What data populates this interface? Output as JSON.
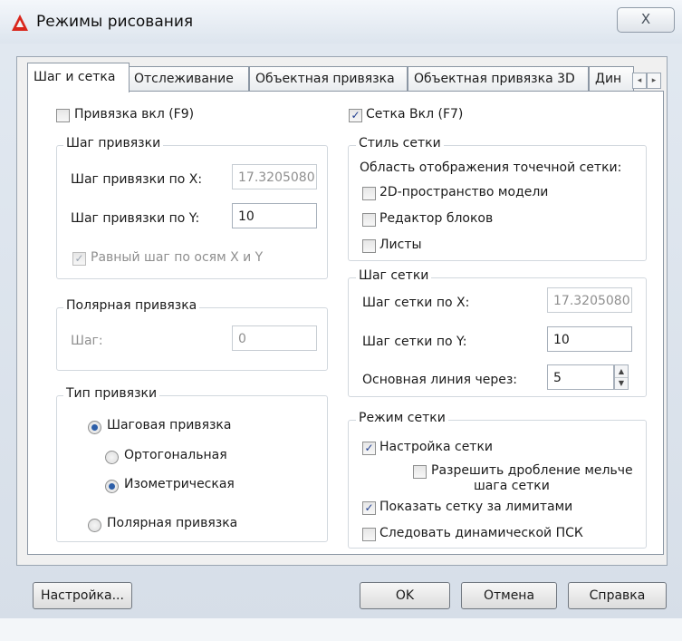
{
  "window": {
    "title": "Режимы рисования",
    "close_glyph": "X"
  },
  "tabs": [
    {
      "label": "Шаг и сетка",
      "active": true
    },
    {
      "label": "Отслеживание",
      "active": false
    },
    {
      "label": "Объектная привязка",
      "active": false
    },
    {
      "label": "Объектная привязка 3D",
      "active": false
    },
    {
      "label": "Дин",
      "active": false
    }
  ],
  "tab_scroll": {
    "left": "◂",
    "right": "▸"
  },
  "snap": {
    "enable": {
      "label": "Привязка вкл (F9)",
      "checked": false
    },
    "spacing": {
      "title": "Шаг привязки",
      "x_label": "Шаг привязки по X:",
      "x_value": "17.3205080",
      "y_label": "Шаг привязки по Y:",
      "y_value": "10",
      "equal": {
        "label": "Равный шаг по осям X и Y",
        "checked": true
      }
    },
    "polar": {
      "title": "Полярная привязка",
      "step_label": "Шаг:",
      "step_value": "0"
    },
    "type": {
      "title": "Тип привязки",
      "grid_snap": {
        "label": "Шаговая привязка",
        "selected": true
      },
      "rectangular": {
        "label": "Ортогональная",
        "selected": false
      },
      "isometric": {
        "label": "Изометрическая",
        "selected": true
      },
      "polar_snap": {
        "label": "Полярная привязка",
        "selected": false
      }
    }
  },
  "grid": {
    "enable": {
      "label": "Сетка Вкл (F7)",
      "checked": true
    },
    "style": {
      "title": "Стиль сетки",
      "subtitle": "Область отображения точечной сетки:",
      "model_space": {
        "label": "2D-пространство модели",
        "checked": false
      },
      "block_editor": {
        "label": "Редактор блоков",
        "checked": false
      },
      "sheets": {
        "label": "Листы",
        "checked": false
      }
    },
    "spacing": {
      "title": "Шаг сетки",
      "x_label": "Шаг сетки по X:",
      "x_value": "17.3205080",
      "y_label": "Шаг сетки по Y:",
      "y_value": "10",
      "major_label": "Основная линия через:",
      "major_value": "5"
    },
    "behavior": {
      "title": "Режим сетки",
      "adaptive": {
        "label": "Настройка сетки",
        "checked": true
      },
      "subdivision": {
        "label_line1": "Разрешить дробление мельче",
        "label_line2": "шага сетки",
        "checked": false
      },
      "beyond_limits": {
        "label": "Показать сетку за лимитами",
        "checked": true
      },
      "follow_ucs": {
        "label": "Следовать динамической ПСК",
        "checked": false
      }
    }
  },
  "buttons": {
    "options": "Настройка...",
    "ok": "OK",
    "cancel": "Отмена",
    "help": "Справка"
  },
  "colors": {
    "check_mark": "#1f3d8f",
    "radio_dot": "#2c5ea8",
    "disabled_text": "#8f8f8f",
    "app_icon": "#d9261c"
  }
}
